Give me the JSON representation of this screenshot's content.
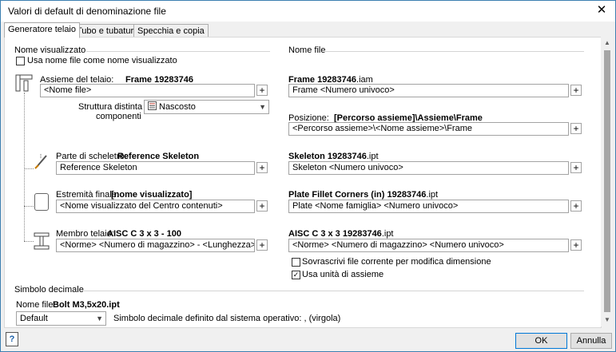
{
  "window": {
    "title": "Valori di default di denominazione file",
    "close_glyph": "✕"
  },
  "tabs": [
    {
      "label": "Generatore telaio",
      "active": true
    },
    {
      "label": "Tubo e tubatura",
      "active": false
    },
    {
      "label": "Specchia e copia",
      "active": false
    }
  ],
  "left": {
    "group_label": "Nome visualizzato",
    "use_filename_checkbox": {
      "label": "Usa nome file come nome visualizzato",
      "checked": false
    },
    "assembly": {
      "label_prefix": "Assieme del telaio:",
      "label_value": "Frame 19283746",
      "value": "<Nome file>"
    },
    "bom": {
      "label_line1": "Struttura distinta",
      "label_line2": "componenti",
      "value": "Nascosto"
    },
    "skeleton": {
      "label_prefix": "Parte di scheletro:",
      "label_value": "Reference Skeleton",
      "value": "Reference Skeleton"
    },
    "endcap": {
      "label_prefix": "Estremità finale:",
      "label_value": "[nome visualizzato]",
      "value": "<Nome visualizzato del Centro contenuti>"
    },
    "member": {
      "label_prefix": "Membro telaio:",
      "label_value": "AISC C 3 x 3 - 100",
      "value": "<Norme> <Numero di magazzino> - <Lunghezza>"
    }
  },
  "right": {
    "group_label": "Nome file",
    "frame": {
      "label_bold": "Frame 19283746",
      "label_ext": ".iam",
      "value": "Frame <Numero univoco>"
    },
    "location": {
      "label_prefix": "Posizione:",
      "label_value": "[Percorso assieme]\\Assieme\\Frame",
      "value": "<Percorso assieme>\\<Nome assieme>\\Frame"
    },
    "skeleton": {
      "label_bold": "Skeleton 19283746",
      "label_ext": ".ipt",
      "value": "Skeleton <Numero univoco>"
    },
    "plate": {
      "label_bold": "Plate Fillet Corners (in) 19283746",
      "label_ext": ".ipt",
      "value": "Plate <Nome famiglia> <Numero univoco>"
    },
    "member": {
      "label_bold": "AISC C 3 x 3 19283746",
      "label_ext": ".ipt",
      "value": "<Norme> <Numero di magazzino> <Numero univoco>"
    },
    "overwrite_checkbox": {
      "label": "Sovrascrivi file corrente per modifica dimensione",
      "checked": false
    },
    "assembly_units_checkbox": {
      "label": "Usa unità di assieme",
      "checked": true
    }
  },
  "decimal": {
    "group_label": "Simbolo decimale",
    "filename_prefix": "Nome file:",
    "filename_value": "Bolt M3,5x20.ipt",
    "select_value": "Default",
    "os_text": "Simbolo decimale definito dal sistema operativo: , (virgola)"
  },
  "footer": {
    "help_glyph": "?",
    "ok_label": "OK",
    "cancel_label": "Annulla"
  },
  "plus_glyph": "+",
  "check_glyph": "✓"
}
